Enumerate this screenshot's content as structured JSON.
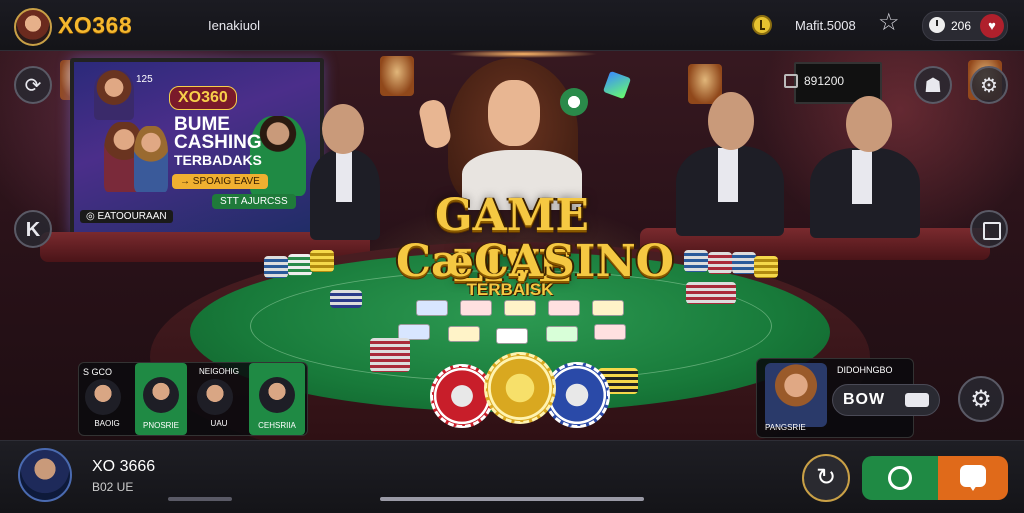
{
  "header": {
    "brand": "XO368",
    "menu_text": "Ienakiuol",
    "balance": "Mafit.5008",
    "pill_value": "206"
  },
  "tv": {
    "logo": "XO360",
    "small_text": "125",
    "headline_1": "BUME",
    "headline_2": "CASHING",
    "headline_3": "TERBADAKS",
    "cta": "→ SPOAIG EAVE",
    "green_button": "STT AJURCSS",
    "tag": "◎ EATOOURAAN"
  },
  "wall_screen": {
    "text": "891200"
  },
  "game_title": {
    "line1": "GAME LIVE",
    "line2": "CASINO",
    "line2_prefix": "Cæ",
    "subtitle": "TERBAISK"
  },
  "players_panel": {
    "label": "S GCO",
    "players": [
      {
        "top": "",
        "bottom": "BAOIG",
        "highlight": false
      },
      {
        "top": "",
        "bottom": "PNOSRIE",
        "highlight": true
      },
      {
        "top": "NEIGOHIG",
        "bottom": "UAU",
        "highlight": false
      },
      {
        "top": "",
        "bottom": "CEHSRIIA",
        "highlight": true
      }
    ]
  },
  "profile_card": {
    "title": "DIDOHNGBO",
    "name": "PANGSRIE",
    "bet_label": "BOW"
  },
  "footer": {
    "user_name": "XO 3666",
    "user_sub": "B02 UE"
  },
  "colors": {
    "accent_gold": "#f5b82e",
    "felt_green": "#187a3a",
    "action_green": "#1f8a44",
    "action_orange": "#e06a1a"
  },
  "icons": {
    "left_top": "refresh-icon",
    "left_mid": "back-icon",
    "right_top_1": "bag-icon",
    "right_top_2": "settings-icon",
    "right_mid": "window-icon",
    "right_bottom": "settings-icon"
  }
}
